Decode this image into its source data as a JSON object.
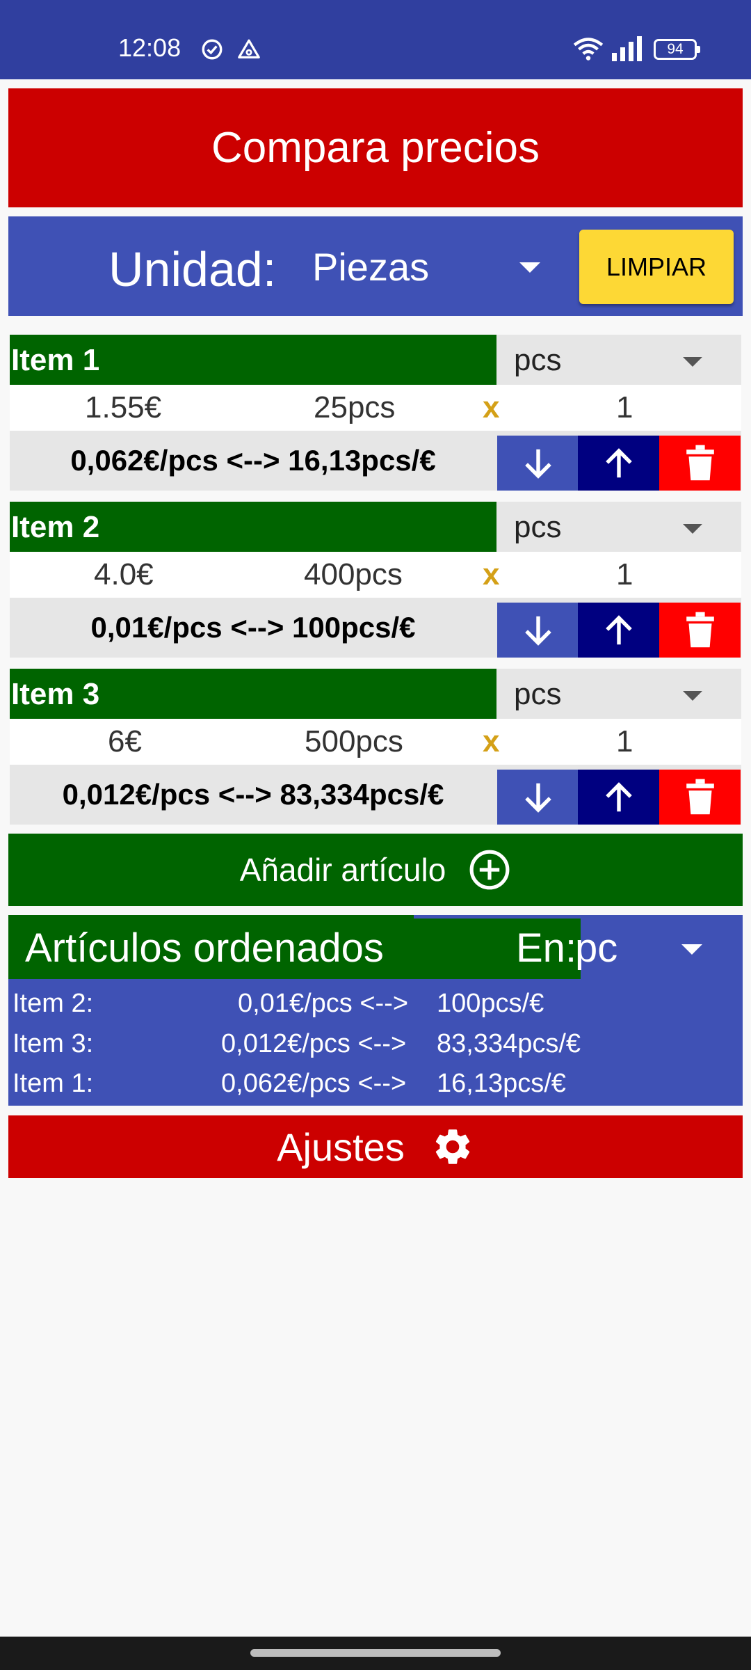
{
  "status_bar": {
    "time": "12:08",
    "battery": "94",
    "icons": [
      "check-circle-icon",
      "triangle-alert-icon",
      "wifi-icon",
      "signal-icon",
      "battery-icon"
    ]
  },
  "app": {
    "title": "Compara precios",
    "unit_label": "Unidad:",
    "unit_value": "Piezas",
    "clear_button": "LIMPIAR"
  },
  "items": [
    {
      "name": "Item 1",
      "unit": "pcs",
      "price": "1.55€",
      "quantity": "25pcs",
      "x": "x",
      "multiplier": "1",
      "result": "0,062€/pcs <--> 16,13pcs/€"
    },
    {
      "name": "Item 2",
      "unit": "pcs",
      "price": "4.0€",
      "quantity": "400pcs",
      "x": "x",
      "multiplier": "1",
      "result": "0,01€/pcs <--> 100pcs/€"
    },
    {
      "name": "Item 3",
      "unit": "pcs",
      "price": "6€",
      "quantity": "500pcs",
      "x": "x",
      "multiplier": "1",
      "result": "0,012€/pcs <--> 83,334pcs/€"
    }
  ],
  "add_button": "Añadir artículo",
  "sorted": {
    "title": "Artículos ordenados",
    "en_label": "En:",
    "unit": "pc",
    "rows": [
      {
        "name": "Item 2:",
        "per_unit": "0,01€/pcs <-->",
        "per_euro": "100pcs/€"
      },
      {
        "name": "Item 3:",
        "per_unit": "0,012€/pcs <-->",
        "per_euro": "83,334pcs/€"
      },
      {
        "name": "Item 1:",
        "per_unit": "0,062€/pcs <-->",
        "per_euro": "16,13pcs/€"
      }
    ]
  },
  "settings_button": "Ajustes",
  "colors": {
    "status_bar": "#303f9f",
    "red": "#cc0000",
    "blue": "#3f51b5",
    "navy": "#000080",
    "green": "#006400",
    "yellow": "#fdd835",
    "delete_red": "#ff0000"
  }
}
